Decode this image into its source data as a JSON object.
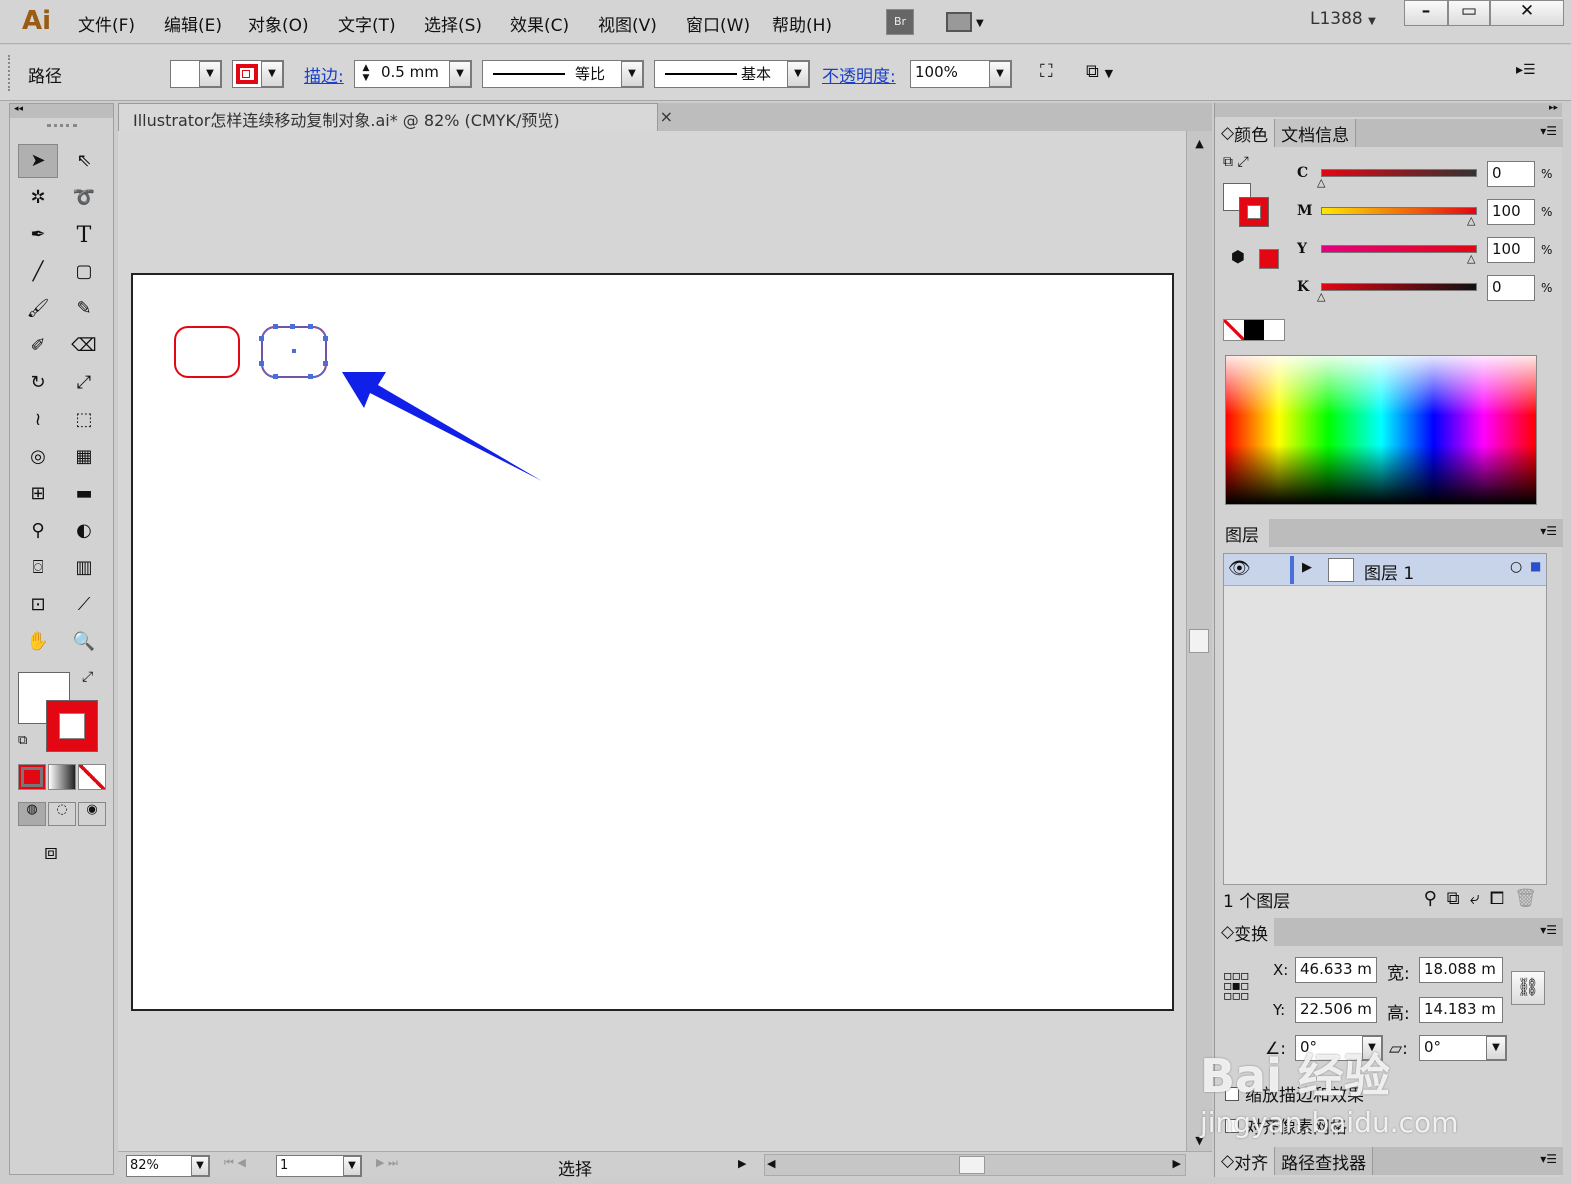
{
  "app": {
    "logo": "Ai",
    "user": "L1388",
    "bridge": "Br"
  },
  "menu": [
    "文件(F)",
    "编辑(E)",
    "对象(O)",
    "文字(T)",
    "选择(S)",
    "效果(C)",
    "视图(V)",
    "窗口(W)",
    "帮助(H)"
  ],
  "control": {
    "object_type": "路径",
    "stroke_label": "描边:",
    "stroke_value": "0.5 mm",
    "profile_label": "等比",
    "brush_label": "基本",
    "opacity_label": "不透明度:",
    "opacity_value": "100%"
  },
  "document": {
    "tab_title": "Illustrator怎样连续移动复制对象.ai* @ 82% (CMYK/预览)",
    "zoom": "82%",
    "page": "1",
    "status": "选择"
  },
  "colors": {
    "fill": "#ffffff",
    "stroke": "#e30613",
    "selection": "#4a6fd8",
    "annotation_arrow": "#1020e8"
  },
  "color_panel": {
    "tabs": [
      "颜色",
      "文档信息"
    ],
    "channels": [
      {
        "label": "C",
        "value": "0",
        "slider_pos": 0
      },
      {
        "label": "M",
        "value": "100",
        "slider_pos": 1
      },
      {
        "label": "Y",
        "value": "100",
        "slider_pos": 1
      },
      {
        "label": "K",
        "value": "0",
        "slider_pos": 0
      }
    ],
    "unit": "%"
  },
  "layers_panel": {
    "tab": "图层",
    "layer_name": "图层 1",
    "count": "1 个图层"
  },
  "transform_panel": {
    "tab": "变换",
    "x_label": "X:",
    "x": "46.633 m",
    "y_label": "Y:",
    "y": "22.506 m",
    "w_label": "宽:",
    "w": "18.088 m",
    "h_label": "高:",
    "h": "14.183 m",
    "angle": "0°",
    "shear": "0°",
    "opt1": "缩放描边和效果",
    "opt2": "对齐像素网格"
  },
  "bottom_tabs": [
    "对齐",
    "路径查找器"
  ],
  "watermark": {
    "line1": "Bai 经验",
    "line2": "jingyan.baidu.com"
  }
}
